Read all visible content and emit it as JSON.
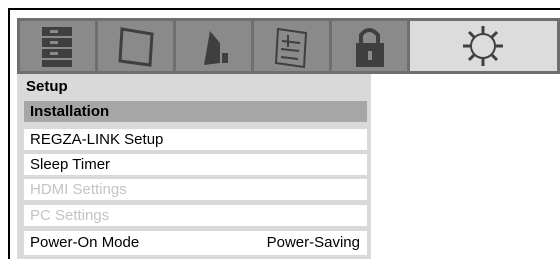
{
  "menu": {
    "tabs": [
      {
        "icon": "picture-settings-icon",
        "active": false
      },
      {
        "icon": "screen-icon",
        "active": false
      },
      {
        "icon": "speaker-icon",
        "active": false
      },
      {
        "icon": "preferences-icon",
        "active": false
      },
      {
        "icon": "lock-icon",
        "active": false
      },
      {
        "icon": "gear-icon",
        "active": true
      }
    ],
    "title": "Setup",
    "items": [
      {
        "label": "Installation",
        "value": "",
        "state": "header"
      },
      {
        "label": "REGZA-LINK Setup",
        "value": "",
        "state": "enabled"
      },
      {
        "label": "Sleep Timer",
        "value": "",
        "state": "enabled"
      },
      {
        "label": "HDMI Settings",
        "value": "",
        "state": "disabled"
      },
      {
        "label": "PC Settings",
        "value": "",
        "state": "disabled"
      },
      {
        "label": "Power-On Mode",
        "value": "Power-Saving",
        "state": "enabled"
      }
    ]
  },
  "colors": {
    "icon_bar": "#6f6f6f",
    "tab": "#8a8a8a",
    "tab_active": "#dcdcdc",
    "panel": "#d9d9d9",
    "header_row": "#a6a6a6",
    "disabled_text": "#c4c4c4"
  }
}
